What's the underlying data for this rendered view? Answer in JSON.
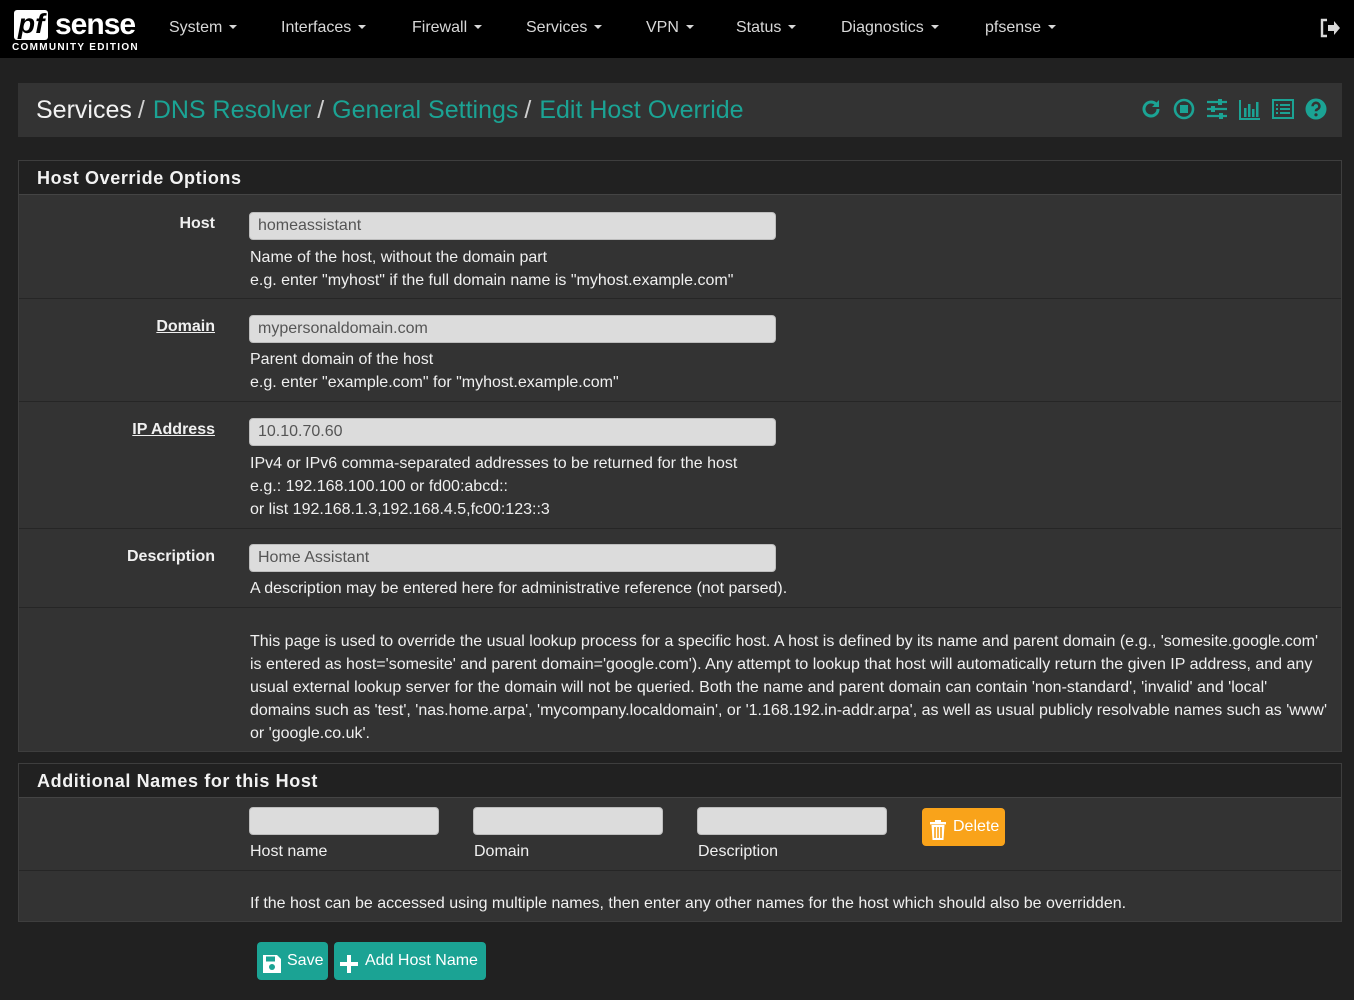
{
  "nav": {
    "logo_main": "sense",
    "logo_pf": "pf",
    "logo_edition": "COMMUNITY EDITION",
    "items": [
      "System",
      "Interfaces",
      "Firewall",
      "Services",
      "VPN",
      "Status",
      "Diagnostics",
      "pfsense"
    ]
  },
  "breadcrumb": {
    "root": "Services",
    "level1": "DNS Resolver",
    "level2": "General Settings",
    "level3": "Edit Host Override",
    "separator": "/"
  },
  "header_icons": [
    "restart-icon",
    "stop-icon",
    "settings-icon",
    "chart-icon",
    "log-icon",
    "help-icon"
  ],
  "host_override": {
    "title": "Host Override Options",
    "host": {
      "label": "Host",
      "value": "homeassistant",
      "help1": "Name of the host, without the domain part",
      "help2": "e.g. enter \"myhost\" if the full domain name is \"myhost.example.com\""
    },
    "domain": {
      "label": "Domain",
      "value": "mypersonaldomain.com",
      "help1": "Parent domain of the host",
      "help2": "e.g. enter \"example.com\" for \"myhost.example.com\""
    },
    "ip": {
      "label": "IP Address",
      "value": "10.10.70.60",
      "help1": "IPv4 or IPv6 comma-separated addresses to be returned for the host",
      "help2": "e.g.: 192.168.100.100 or fd00:abcd::",
      "help3": "or list 192.168.1.3,192.168.4.5,fc00:123::3"
    },
    "description": {
      "label": "Description",
      "value": "Home Assistant",
      "help1": "A description may be entered here for administrative reference (not parsed)."
    },
    "info_lines": [
      "This page is used to override the usual lookup process for a specific host. A host is defined by its name and parent domain (e.g., 'somesite.google.com'",
      "is entered as host='somesite' and parent domain='google.com'). Any attempt to lookup that host will automatically return the given IP address, and any",
      "usual external lookup server for the domain will not be queried. Both the name and parent domain can contain 'non-standard', 'invalid' and 'local'",
      "domains such as 'test', 'nas.home.arpa', 'mycompany.localdomain', or '1.168.192.in-addr.arpa', as well as usual publicly resolvable names such as 'www'",
      "or 'google.co.uk'."
    ]
  },
  "additional": {
    "title": "Additional Names for this Host",
    "host_name_label": "Host name",
    "domain_label": "Domain",
    "description_label": "Description",
    "host_name_value": "",
    "domain_value": "",
    "description_value": "",
    "delete_label": "Delete",
    "help": "If the host can be accessed using multiple names, then enter any other names for the host which should also be overridden."
  },
  "actions": {
    "save_label": "Save",
    "add_label": "Add Host Name"
  },
  "colors": {
    "accent": "#1ba394",
    "warning": "#f9a31a",
    "panel": "#333333",
    "background": "#212121"
  }
}
